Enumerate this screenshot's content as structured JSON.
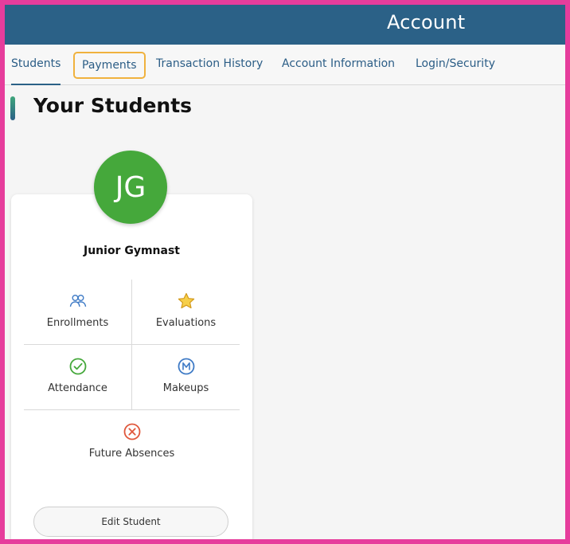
{
  "header": {
    "title": "Account"
  },
  "tabs": [
    {
      "label": "Students"
    },
    {
      "label": "Payments"
    },
    {
      "label": "Transaction History"
    },
    {
      "label": "Account Information"
    },
    {
      "label": "Login/Security"
    }
  ],
  "page": {
    "title": "Your Students"
  },
  "student": {
    "initials": "JG",
    "name": "Junior Gymnast",
    "actions": [
      {
        "label": "Enrollments",
        "icon": "people-icon"
      },
      {
        "label": "Evaluations",
        "icon": "star-icon"
      },
      {
        "label": "Attendance",
        "icon": "check-circle-icon"
      },
      {
        "label": "Makeups",
        "icon": "makeup-m-icon"
      },
      {
        "label": "Future Absences",
        "icon": "x-circle-icon"
      }
    ],
    "edit_label": "Edit Student"
  },
  "colors": {
    "header_bg": "#2b6187",
    "tab_text": "#2b5d86",
    "focus_outline": "#f0b23e",
    "avatar_bg": "#45a83b",
    "frame_border": "#e63d9c"
  }
}
